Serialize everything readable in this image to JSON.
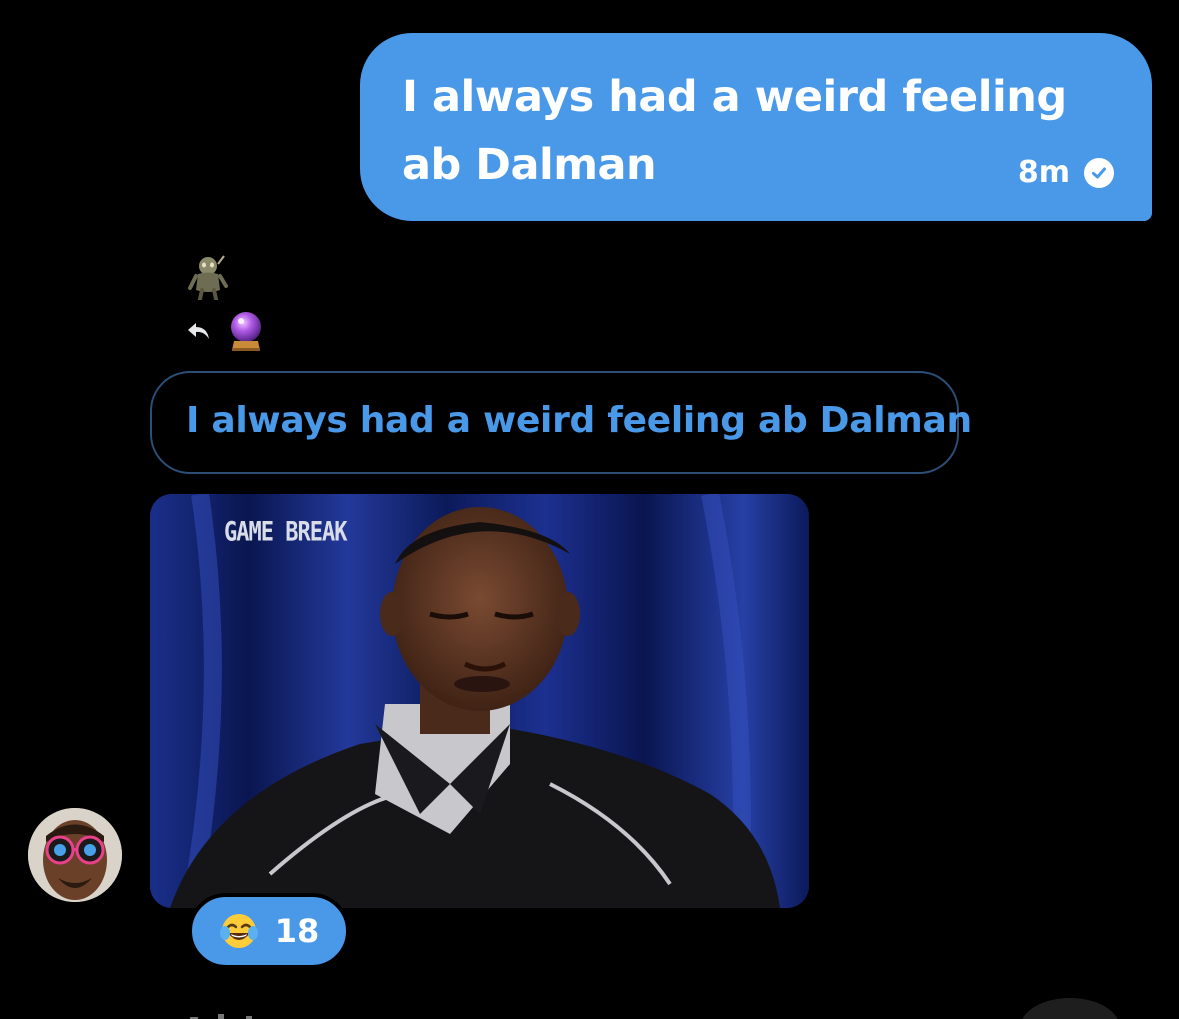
{
  "outgoing_message": {
    "text": "I always had a weird feeling ab Dalman",
    "time": "8m",
    "status_icon": "check-circle-icon",
    "bubble_color": "#4a99e9"
  },
  "incoming": {
    "sticker_icon": "creature-sticker-icon",
    "reply_icon": "reply-arrow-icon",
    "reply_emoji": "crystal-ball-icon",
    "quoted_text": "I always had a weird feeling ab Dalman",
    "gif_caption": "GAME BREAK",
    "avatar": "avatar-icon"
  },
  "reaction": {
    "emoji": "tears-of-joy-icon",
    "count": "18"
  },
  "colors": {
    "accent": "#4a99e9",
    "background": "#000000",
    "quote_border": "#2c4f78"
  }
}
